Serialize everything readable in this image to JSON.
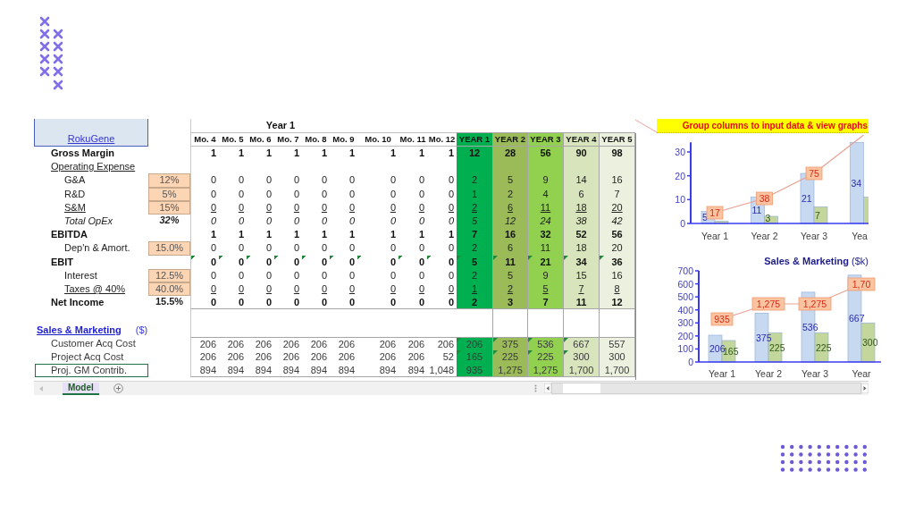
{
  "sheet": {
    "company": "RokuGene",
    "group_header": "Year 1",
    "month_columns": [
      "Mo. 4",
      "Mo. 5",
      "Mo. 6",
      "Mo. 7",
      "Mo. 8",
      "Mo. 9",
      "Mo. 10",
      "Mo. 11",
      "Mo. 12"
    ],
    "year_columns": [
      {
        "label": "YEAR 1",
        "color": "#00b050"
      },
      {
        "label": "YEAR 2",
        "color": "#9bbb59"
      },
      {
        "label": "YEAR 3",
        "color": "#92d050"
      },
      {
        "label": "YEAR 4",
        "color": "#d8e4bc"
      },
      {
        "label": "YEAR 5",
        "color": "#ebf1de"
      }
    ],
    "rows": [
      {
        "label": "Gross Margin",
        "kind": "total",
        "months": [
          "1",
          "1",
          "1",
          "1",
          "1",
          "1",
          "1",
          "1",
          "1"
        ],
        "years": [
          "12",
          "28",
          "56",
          "90",
          "98"
        ],
        "month_flags": false,
        "year_flags": [
          false,
          false,
          false,
          false,
          false
        ]
      },
      {
        "label": "Operating Expense",
        "kind": "section"
      },
      {
        "label": "G&A",
        "kind": "item",
        "rate": {
          "value": "12%",
          "input": true
        },
        "months": [
          "0",
          "0",
          "0",
          "0",
          "0",
          "0",
          "0",
          "0",
          "0"
        ],
        "years": [
          "2",
          "5",
          "9",
          "14",
          "16"
        ],
        "month_flags": false,
        "year_flags": [
          false,
          false,
          false,
          false,
          false
        ]
      },
      {
        "label": "R&D",
        "kind": "item",
        "rate": {
          "value": "5%",
          "input": true
        },
        "months": [
          "0",
          "0",
          "0",
          "0",
          "0",
          "0",
          "0",
          "0",
          "0"
        ],
        "years": [
          "1",
          "2",
          "4",
          "6",
          "7"
        ],
        "month_flags": false,
        "year_flags": [
          false,
          false,
          false,
          false,
          false
        ]
      },
      {
        "label": "S&M",
        "kind": "item_underline",
        "rate": {
          "value": "15%",
          "input": true
        },
        "months": [
          "0",
          "0",
          "0",
          "0",
          "0",
          "0",
          "0",
          "0",
          "0"
        ],
        "years": [
          "2",
          "6",
          "11",
          "18",
          "20"
        ],
        "month_flags": false,
        "year_flags": [
          false,
          false,
          false,
          false,
          false
        ]
      },
      {
        "label": "Total OpEx",
        "kind": "item_italic",
        "rate": {
          "value": "32%",
          "input": false
        },
        "months": [
          "0",
          "0",
          "0",
          "0",
          "0",
          "0",
          "0",
          "0",
          "0"
        ],
        "years": [
          "5",
          "12",
          "24",
          "38",
          "42"
        ],
        "month_flags": false,
        "year_flags": [
          false,
          false,
          false,
          false,
          false
        ]
      },
      {
        "label": "EBITDA",
        "kind": "total",
        "months": [
          "1",
          "1",
          "1",
          "1",
          "1",
          "1",
          "1",
          "1",
          "1"
        ],
        "years": [
          "7",
          "16",
          "32",
          "52",
          "56"
        ],
        "month_flags": false,
        "year_flags": [
          false,
          false,
          false,
          false,
          false
        ]
      },
      {
        "label": "Dep'n & Amort.",
        "kind": "item",
        "rate": {
          "value": "15.0%",
          "input": true
        },
        "months": [
          "0",
          "0",
          "0",
          "0",
          "0",
          "0",
          "0",
          "0",
          "0"
        ],
        "years": [
          "2",
          "6",
          "11",
          "18",
          "20"
        ],
        "month_flags": false,
        "year_flags": [
          false,
          false,
          false,
          false,
          false
        ]
      },
      {
        "label": "EBIT",
        "kind": "total",
        "months": [
          "0",
          "0",
          "0",
          "0",
          "0",
          "0",
          "0",
          "0",
          "0"
        ],
        "years": [
          "5",
          "11",
          "21",
          "34",
          "36"
        ],
        "month_flags": true,
        "year_flags": [
          true,
          true,
          true,
          true,
          true
        ]
      },
      {
        "label": "Interest",
        "kind": "item",
        "rate": {
          "value": "12.5%",
          "input": true
        },
        "months": [
          "0",
          "0",
          "0",
          "0",
          "0",
          "0",
          "0",
          "0",
          "0"
        ],
        "years": [
          "2",
          "5",
          "9",
          "15",
          "16"
        ],
        "month_flags": false,
        "year_flags": [
          false,
          false,
          false,
          false,
          false
        ]
      },
      {
        "label": "Taxes @ 40%",
        "kind": "item_underline",
        "rate": {
          "value": "40.0%",
          "input": true
        },
        "months": [
          "0",
          "0",
          "0",
          "0",
          "0",
          "0",
          "0",
          "0",
          "0"
        ],
        "years": [
          "1",
          "2",
          "5",
          "7",
          "8"
        ],
        "month_flags": false,
        "year_flags": [
          false,
          false,
          false,
          false,
          false
        ]
      },
      {
        "label": "Net Income",
        "kind": "total",
        "rate": {
          "value": "15.5%",
          "input": false
        },
        "months": [
          "0",
          "0",
          "0",
          "0",
          "0",
          "0",
          "0",
          "0",
          "0"
        ],
        "years": [
          "2",
          "3",
          "7",
          "11",
          "12"
        ],
        "month_flags": false,
        "year_flags": [
          false,
          false,
          false,
          false,
          false
        ]
      }
    ],
    "sm_section": {
      "title": "Sales & Marketing",
      "unit": "($)",
      "rows": [
        {
          "label": "Customer Acq Cost",
          "selected": false,
          "months": [
            "206",
            "206",
            "206",
            "206",
            "206",
            "206",
            "206",
            "206",
            "206"
          ],
          "years": [
            "206",
            "375",
            "536",
            "667",
            "557"
          ],
          "month_flags": false,
          "year_flags": [
            true,
            true,
            true,
            true,
            false
          ]
        },
        {
          "label": "Project Acq Cost",
          "selected": false,
          "months": [
            "206",
            "206",
            "206",
            "206",
            "206",
            "206",
            "206",
            "206",
            "52"
          ],
          "years": [
            "165",
            "225",
            "225",
            "300",
            "300"
          ],
          "month_flags": false,
          "year_flags": [
            true,
            true,
            true,
            true,
            false
          ]
        },
        {
          "label": "Proj. GM Contrib.",
          "selected": true,
          "months": [
            "894",
            "894",
            "894",
            "894",
            "894",
            "894",
            "894",
            "894",
            "1,048"
          ],
          "years": [
            "935",
            "1,275",
            "1,275",
            "1,700",
            "1,700"
          ],
          "month_flags": false,
          "year_flags": [
            false,
            false,
            false,
            false,
            false
          ]
        }
      ]
    }
  },
  "note": "Group columns to input data & view graphs",
  "charts": [
    {
      "chart_data": {
        "type": "bar",
        "categories": [
          "Year 1",
          "Year 2",
          "Year 3",
          "Yea"
        ],
        "ylim": [
          0,
          34
        ],
        "yticks": [
          0,
          10,
          20,
          30
        ],
        "data_labels": true,
        "series": [
          {
            "color": "#c6d9f1",
            "values": [
              5,
              11,
              21,
              34
            ],
            "value_labels": [
              "5",
              "11",
              "21",
              "34"
            ]
          },
          {
            "color": "#c3d69b",
            "values": [
              1,
              3,
              7,
              11
            ],
            "value_labels": [
              null,
              "3",
              "7",
              null
            ]
          }
        ]
      },
      "line_labels": [
        "17",
        "38",
        "75"
      ]
    },
    {
      "chart_data": {
        "type": "bar",
        "title": "**Sales & Marketing** ($k)",
        "categories": [
          "Year 1",
          "Year 2",
          "Year 3",
          "Year"
        ],
        "ylim": [
          0,
          700
        ],
        "yticks": [
          0,
          100,
          200,
          300,
          400,
          500,
          600,
          700
        ],
        "data_labels": true,
        "series": [
          {
            "color": "#c6d9f1",
            "values": [
              206,
              375,
              536,
              667
            ],
            "value_labels": [
              "206",
              "375",
              "536",
              "667"
            ]
          },
          {
            "color": "#c3d69b",
            "values": [
              165,
              225,
              225,
              300
            ],
            "value_labels": [
              "165",
              "225",
              "225",
              "300"
            ]
          }
        ]
      },
      "line_labels": [
        "935",
        "1,275",
        "1,275",
        "1,70"
      ]
    }
  ],
  "sheet_tabs": [
    {
      "label": "Model",
      "selected": true
    }
  ]
}
